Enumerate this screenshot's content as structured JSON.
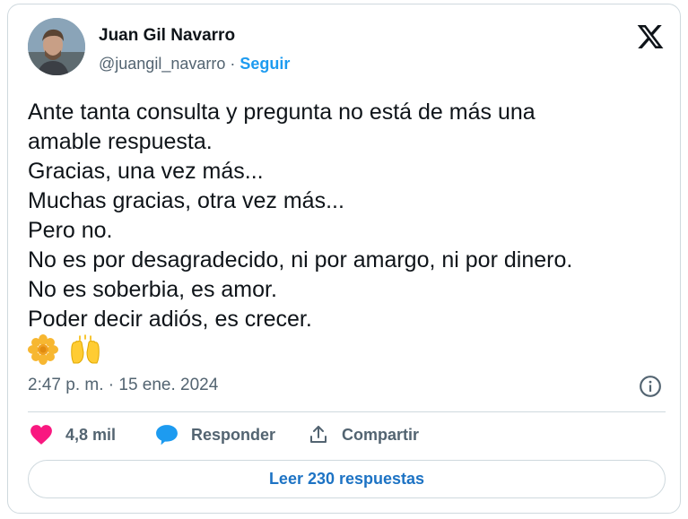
{
  "author": {
    "name": "Juan Gil Navarro",
    "handle": "@juangil_navarro",
    "separator": " · ",
    "follow_label": "Seguir"
  },
  "tweet": {
    "lines": [
      "Ante tanta consulta y pregunta no está de más una",
      "amable respuesta.",
      "Gracias, una vez más...",
      "Muchas gracias, otra vez más...",
      "Pero no.",
      "No es por desagradecido, ni por amargo, ni por dinero.",
      "No es soberbia, es amor.",
      "Poder decir adiós, es crecer."
    ],
    "emojis": [
      "🌼",
      "🙌"
    ],
    "timestamp": "2:47 p. m. · 15 ene. 2024"
  },
  "actions": {
    "likes": "4,8 mil",
    "reply_label": "Responder",
    "share_label": "Compartir"
  },
  "read_replies_label": "Leer 230 respuestas",
  "colors": {
    "accent": "#1d9bf0",
    "heart": "#f91880",
    "text": "#0f1419",
    "muted": "#536471"
  }
}
